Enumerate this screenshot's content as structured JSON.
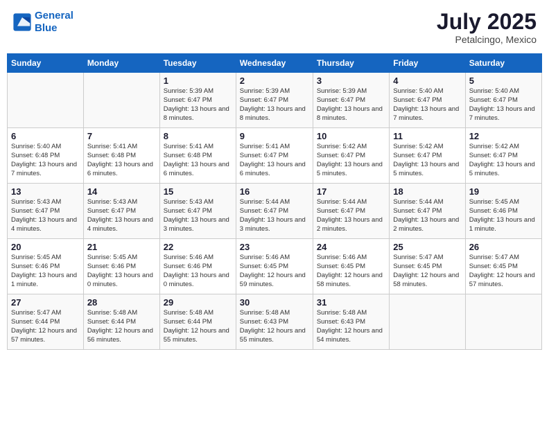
{
  "header": {
    "logo_line1": "General",
    "logo_line2": "Blue",
    "month_year": "July 2025",
    "location": "Petalcingo, Mexico"
  },
  "days_of_week": [
    "Sunday",
    "Monday",
    "Tuesday",
    "Wednesday",
    "Thursday",
    "Friday",
    "Saturday"
  ],
  "weeks": [
    [
      {
        "day": "",
        "info": ""
      },
      {
        "day": "",
        "info": ""
      },
      {
        "day": "1",
        "info": "Sunrise: 5:39 AM\nSunset: 6:47 PM\nDaylight: 13 hours and 8 minutes."
      },
      {
        "day": "2",
        "info": "Sunrise: 5:39 AM\nSunset: 6:47 PM\nDaylight: 13 hours and 8 minutes."
      },
      {
        "day": "3",
        "info": "Sunrise: 5:39 AM\nSunset: 6:47 PM\nDaylight: 13 hours and 8 minutes."
      },
      {
        "day": "4",
        "info": "Sunrise: 5:40 AM\nSunset: 6:47 PM\nDaylight: 13 hours and 7 minutes."
      },
      {
        "day": "5",
        "info": "Sunrise: 5:40 AM\nSunset: 6:47 PM\nDaylight: 13 hours and 7 minutes."
      }
    ],
    [
      {
        "day": "6",
        "info": "Sunrise: 5:40 AM\nSunset: 6:48 PM\nDaylight: 13 hours and 7 minutes."
      },
      {
        "day": "7",
        "info": "Sunrise: 5:41 AM\nSunset: 6:48 PM\nDaylight: 13 hours and 6 minutes."
      },
      {
        "day": "8",
        "info": "Sunrise: 5:41 AM\nSunset: 6:48 PM\nDaylight: 13 hours and 6 minutes."
      },
      {
        "day": "9",
        "info": "Sunrise: 5:41 AM\nSunset: 6:47 PM\nDaylight: 13 hours and 6 minutes."
      },
      {
        "day": "10",
        "info": "Sunrise: 5:42 AM\nSunset: 6:47 PM\nDaylight: 13 hours and 5 minutes."
      },
      {
        "day": "11",
        "info": "Sunrise: 5:42 AM\nSunset: 6:47 PM\nDaylight: 13 hours and 5 minutes."
      },
      {
        "day": "12",
        "info": "Sunrise: 5:42 AM\nSunset: 6:47 PM\nDaylight: 13 hours and 5 minutes."
      }
    ],
    [
      {
        "day": "13",
        "info": "Sunrise: 5:43 AM\nSunset: 6:47 PM\nDaylight: 13 hours and 4 minutes."
      },
      {
        "day": "14",
        "info": "Sunrise: 5:43 AM\nSunset: 6:47 PM\nDaylight: 13 hours and 4 minutes."
      },
      {
        "day": "15",
        "info": "Sunrise: 5:43 AM\nSunset: 6:47 PM\nDaylight: 13 hours and 3 minutes."
      },
      {
        "day": "16",
        "info": "Sunrise: 5:44 AM\nSunset: 6:47 PM\nDaylight: 13 hours and 3 minutes."
      },
      {
        "day": "17",
        "info": "Sunrise: 5:44 AM\nSunset: 6:47 PM\nDaylight: 13 hours and 2 minutes."
      },
      {
        "day": "18",
        "info": "Sunrise: 5:44 AM\nSunset: 6:47 PM\nDaylight: 13 hours and 2 minutes."
      },
      {
        "day": "19",
        "info": "Sunrise: 5:45 AM\nSunset: 6:46 PM\nDaylight: 13 hours and 1 minute."
      }
    ],
    [
      {
        "day": "20",
        "info": "Sunrise: 5:45 AM\nSunset: 6:46 PM\nDaylight: 13 hours and 1 minute."
      },
      {
        "day": "21",
        "info": "Sunrise: 5:45 AM\nSunset: 6:46 PM\nDaylight: 13 hours and 0 minutes."
      },
      {
        "day": "22",
        "info": "Sunrise: 5:46 AM\nSunset: 6:46 PM\nDaylight: 13 hours and 0 minutes."
      },
      {
        "day": "23",
        "info": "Sunrise: 5:46 AM\nSunset: 6:45 PM\nDaylight: 12 hours and 59 minutes."
      },
      {
        "day": "24",
        "info": "Sunrise: 5:46 AM\nSunset: 6:45 PM\nDaylight: 12 hours and 58 minutes."
      },
      {
        "day": "25",
        "info": "Sunrise: 5:47 AM\nSunset: 6:45 PM\nDaylight: 12 hours and 58 minutes."
      },
      {
        "day": "26",
        "info": "Sunrise: 5:47 AM\nSunset: 6:45 PM\nDaylight: 12 hours and 57 minutes."
      }
    ],
    [
      {
        "day": "27",
        "info": "Sunrise: 5:47 AM\nSunset: 6:44 PM\nDaylight: 12 hours and 57 minutes."
      },
      {
        "day": "28",
        "info": "Sunrise: 5:48 AM\nSunset: 6:44 PM\nDaylight: 12 hours and 56 minutes."
      },
      {
        "day": "29",
        "info": "Sunrise: 5:48 AM\nSunset: 6:44 PM\nDaylight: 12 hours and 55 minutes."
      },
      {
        "day": "30",
        "info": "Sunrise: 5:48 AM\nSunset: 6:43 PM\nDaylight: 12 hours and 55 minutes."
      },
      {
        "day": "31",
        "info": "Sunrise: 5:48 AM\nSunset: 6:43 PM\nDaylight: 12 hours and 54 minutes."
      },
      {
        "day": "",
        "info": ""
      },
      {
        "day": "",
        "info": ""
      }
    ]
  ]
}
